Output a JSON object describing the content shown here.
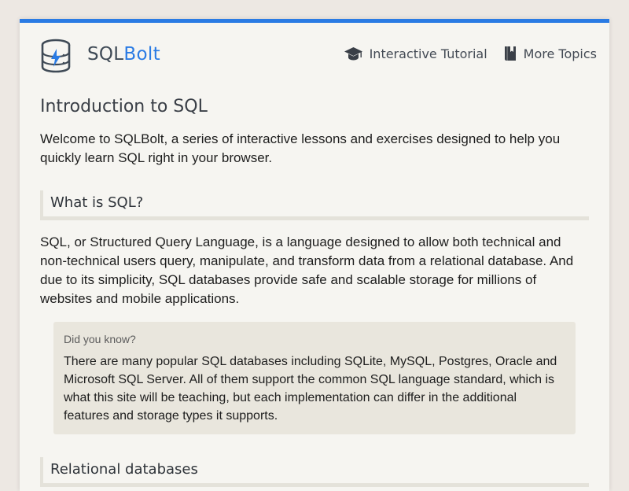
{
  "header": {
    "brand_prefix": "SQL",
    "brand_suffix": "Bolt",
    "logo_icon": "database-bolt-icon",
    "accent_color": "#2a7be4"
  },
  "nav": {
    "items": [
      {
        "label": "Interactive Tutorial",
        "icon": "graduation-cap-icon"
      },
      {
        "label": "More Topics",
        "icon": "book-icon"
      }
    ]
  },
  "main": {
    "title": "Introduction to SQL",
    "intro": "Welcome to SQLBolt, a series of interactive lessons and exercises designed to help you quickly learn SQL right in your browser.",
    "sections": [
      {
        "heading": "What is SQL?",
        "text": "SQL, or Structured Query Language, is a language designed to allow both technical and non-technical users query, manipulate, and transform data from a relational database. And due to its simplicity, SQL databases provide safe and scalable storage for millions of websites and mobile applications."
      },
      {
        "heading": "Relational databases"
      }
    ],
    "callout": {
      "label": "Did you know?",
      "text": "There are many popular SQL databases including SQLite, MySQL, Postgres, Oracle and Microsoft SQL Server. All of them support the common SQL language standard, which is what this site will be teaching, but each implementation can differ in the additional features and storage types it supports."
    }
  }
}
